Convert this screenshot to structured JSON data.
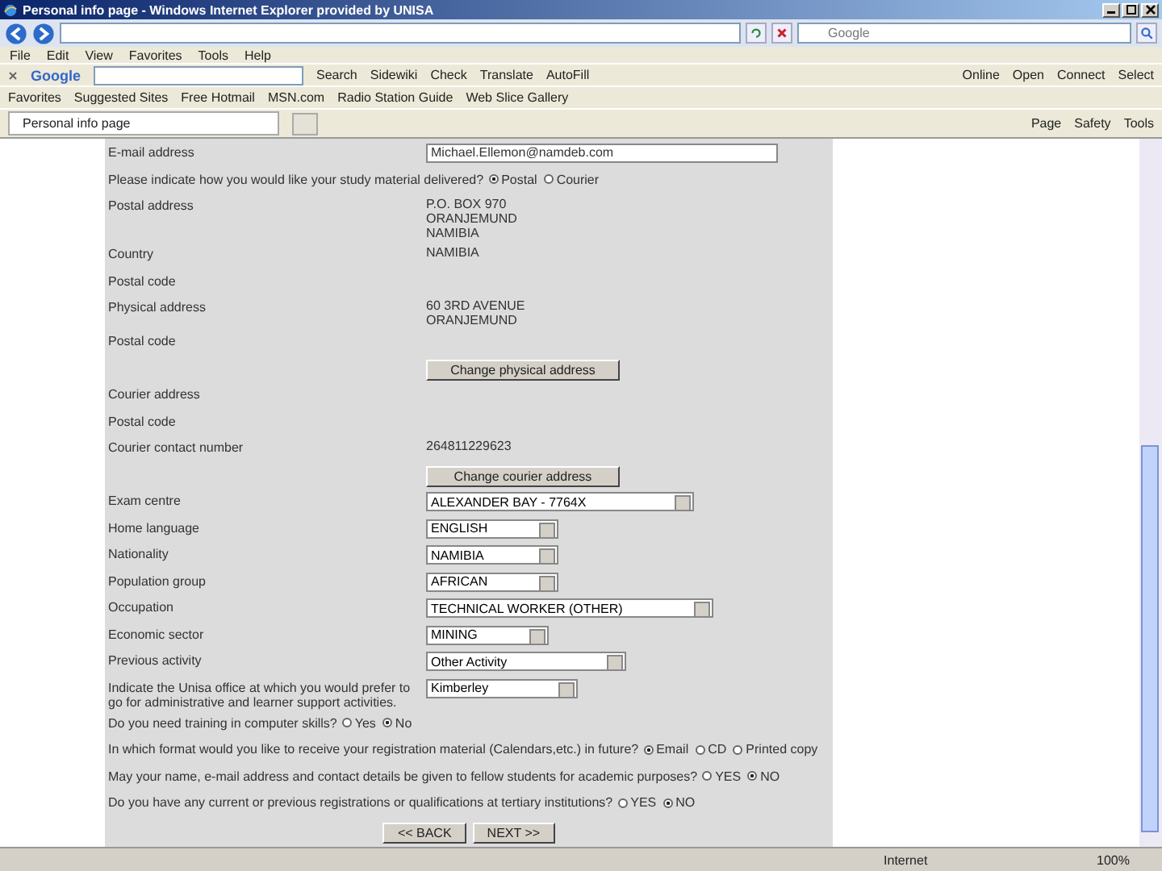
{
  "window": {
    "title": "Personal info page - Windows Internet Explorer provided by UNISA"
  },
  "address_bar": {
    "search_placeholder": "Google"
  },
  "menu": [
    "File",
    "Edit",
    "View",
    "Favorites",
    "Tools",
    "Help"
  ],
  "google_toolbar": {
    "brand": "Google",
    "search_label": "Search",
    "items": [
      "Sidewiki",
      "Check",
      "Translate",
      "AutoFill"
    ],
    "right_items": [
      "Online",
      "Open",
      "Connect",
      "Select"
    ]
  },
  "favorites_bar": {
    "label": "Favorites",
    "items": [
      "Suggested Sites",
      "Free Hotmail",
      "MSN.com",
      "Radio Station Guide",
      "Web Slice Gallery"
    ]
  },
  "tabs": [
    {
      "label": "Personal info page",
      "selected": true
    }
  ],
  "command_bar": [
    "Page",
    "Safety",
    "Tools"
  ],
  "form": {
    "rows": [
      {
        "kind": "field",
        "label": "E-mail address",
        "value": "Michael.Ellemon@namdeb.com"
      },
      {
        "kind": "question",
        "text": "Please indicate how you would like your study material delivered?",
        "options": [
          {
            "label": "Postal",
            "selected": true
          },
          {
            "label": "Courier",
            "selected": false
          }
        ]
      },
      {
        "kind": "text",
        "label": "Postal address",
        "lines": [
          "P.O. BOX 970",
          "ORANJEMUND",
          "NAMIBIA"
        ]
      },
      {
        "kind": "text",
        "label": "Country",
        "lines": [
          "NAMIBIA"
        ]
      },
      {
        "kind": "text",
        "label": "Postal code",
        "lines": []
      },
      {
        "kind": "text",
        "label": "Physical address",
        "lines": [
          "60 3RD AVENUE",
          "ORANJEMUND"
        ]
      },
      {
        "kind": "text",
        "label": "Postal code",
        "lines": []
      },
      {
        "kind": "button",
        "label": "Change physical address"
      },
      {
        "kind": "text",
        "label": "Courier address",
        "lines": []
      },
      {
        "kind": "text",
        "label": "Postal code",
        "lines": []
      },
      {
        "kind": "text",
        "label": "Courier contact number",
        "lines": [
          "264811229623"
        ]
      },
      {
        "kind": "button",
        "label": "Change courier address"
      },
      {
        "kind": "select",
        "label": "Exam centre",
        "value": "ALEXANDER BAY - 7764X"
      },
      {
        "kind": "select",
        "label": "Home language",
        "value": "ENGLISH"
      },
      {
        "kind": "select",
        "label": "Nationality",
        "value": "NAMIBIA"
      },
      {
        "kind": "select",
        "label": "Population group",
        "value": "AFRICAN"
      },
      {
        "kind": "select",
        "label": "Occupation",
        "value": "TECHNICAL WORKER (OTHER)"
      },
      {
        "kind": "select",
        "label": "Economic sector",
        "value": "MINING"
      },
      {
        "kind": "select",
        "label": "Previous activity",
        "value": "Other Activity"
      },
      {
        "kind": "select",
        "label": "Indicate the Unisa office at which you would prefer to go for administrative and learner support activities.",
        "value": "Kimberley"
      },
      {
        "kind": "question",
        "text": "Do you need training in computer skills?",
        "options": [
          {
            "label": "Yes",
            "selected": false
          },
          {
            "label": "No",
            "selected": true
          }
        ]
      },
      {
        "kind": "question",
        "text": "In which format would you like to receive your registration material (Calendars,etc.) in future?",
        "options": [
          {
            "label": "Email",
            "selected": true
          },
          {
            "label": "CD",
            "selected": false
          },
          {
            "label": "Printed copy",
            "selected": false
          }
        ]
      },
      {
        "kind": "question",
        "text": "May your name, e-mail address and contact details be given to fellow students for academic purposes?",
        "options": [
          {
            "label": "YES",
            "selected": false
          },
          {
            "label": "NO",
            "selected": true
          }
        ]
      },
      {
        "kind": "question",
        "text": "Do you have any current or previous registrations or qualifications at tertiary institutions?",
        "options": [
          {
            "label": "YES",
            "selected": false
          },
          {
            "label": "NO",
            "selected": true
          }
        ]
      }
    ],
    "buttons": [
      "<< BACK",
      "NEXT >>"
    ]
  },
  "status_bar": {
    "zone": "Internet",
    "zoom": "100%"
  }
}
